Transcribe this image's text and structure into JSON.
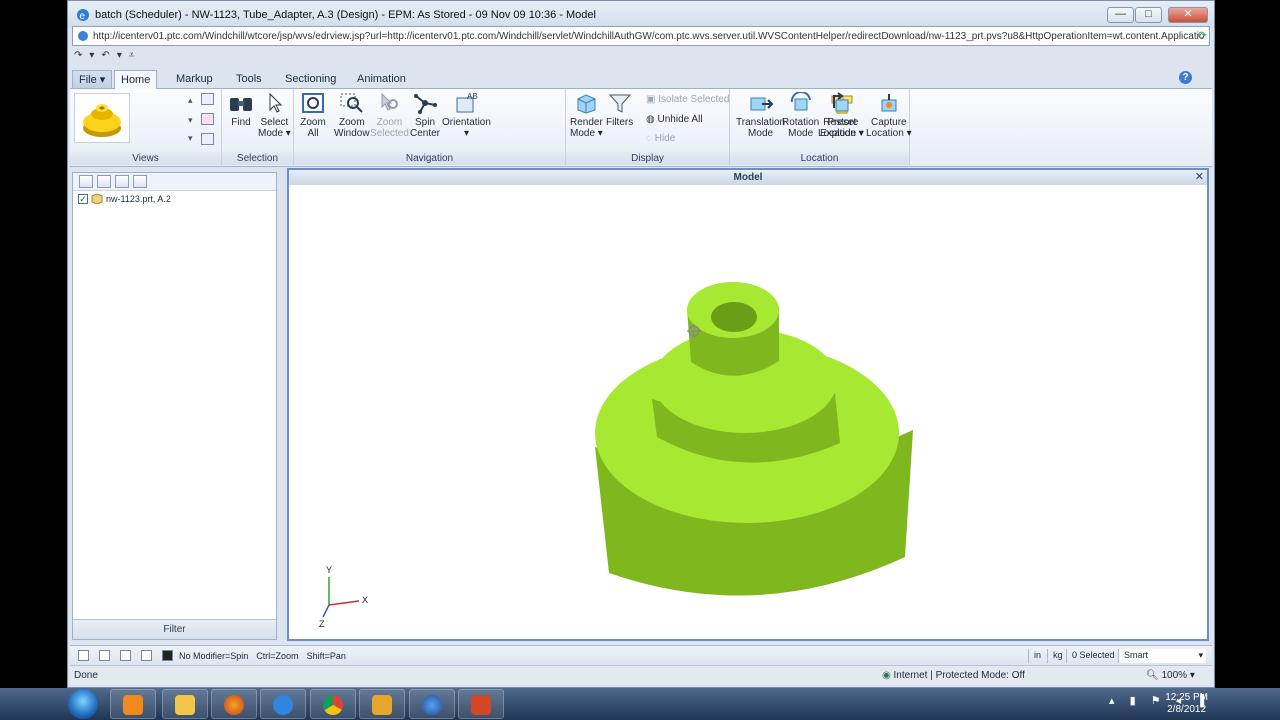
{
  "window": {
    "title": "batch (Scheduler) - NW-1123, Tube_Adapter, A.3 (Design) - EPM: As Stored - 09 Nov 09 10:36 - Model",
    "minimize": "—",
    "maximize": "□",
    "close": "✕"
  },
  "address": {
    "url": "http://icenterv01.ptc.com/Windchill/wtcore/jsp/wvs/edrview.jsp?url=http://icenterv01.ptc.com/Windchill/servlet/WindchillAuthGW/com.ptc.wvs.server.util.WVSContentHelper/redirectDownload/nw-1123_prt.pvs?u8&HttpOperationItem=wt.content.Applicatio"
  },
  "tabs": {
    "file": "File ▾",
    "home": "Home",
    "markup": "Markup",
    "tools": "Tools",
    "sectioning": "Sectioning",
    "animation": "Animation"
  },
  "ribbon": {
    "groups": {
      "views": "Views",
      "selection": "Selection",
      "navigation": "Navigation",
      "display": "Display",
      "location": "Location"
    },
    "find": "Find",
    "select_mode": [
      "Select",
      "Mode ▾"
    ],
    "zoom_all": [
      "Zoom",
      "All"
    ],
    "zoom_window": [
      "Zoom",
      "Window"
    ],
    "zoom_selected": [
      "Zoom",
      "Selected"
    ],
    "spin_center": [
      "Spin",
      "Center"
    ],
    "orientation": [
      "Orientation",
      "▾"
    ],
    "render_mode": [
      "Render",
      "Mode ▾"
    ],
    "filters": "Filters",
    "isolate_selected": "Isolate Selected",
    "unhide_all": "Unhide All",
    "hide": "Hide",
    "translation_mode": [
      "Translation",
      "Mode"
    ],
    "rotation_mode": [
      "Rotation",
      "Mode"
    ],
    "preset_explode": [
      "Preset",
      "Explode ▾"
    ],
    "restore_location": [
      "Restore",
      "Location ▾"
    ],
    "capture_location": [
      "Capture",
      "Location ▾"
    ]
  },
  "tree": {
    "item": "nw-1123.prt, A.2",
    "filter": "Filter"
  },
  "model": {
    "title": "Model",
    "axis": {
      "x": "X",
      "y": "Y",
      "z": "Z"
    },
    "colors": {
      "top": "#a6e832",
      "side": "#7fb81e",
      "dark": "#6a9e17"
    }
  },
  "status": {
    "hint1": "No Modifier=Spin",
    "hint2": "Ctrl=Zoom",
    "hint3": "Shift=Pan",
    "unit_length": "in",
    "unit_mass": "kg",
    "selected": "0 Selected",
    "mode": "Smart"
  },
  "ie_status": {
    "done": "Done",
    "zone": "Internet | Protected Mode: Off",
    "zoom": "100%"
  },
  "taskbar": {
    "time": "12:25 PM",
    "date": "2/8/2012"
  }
}
